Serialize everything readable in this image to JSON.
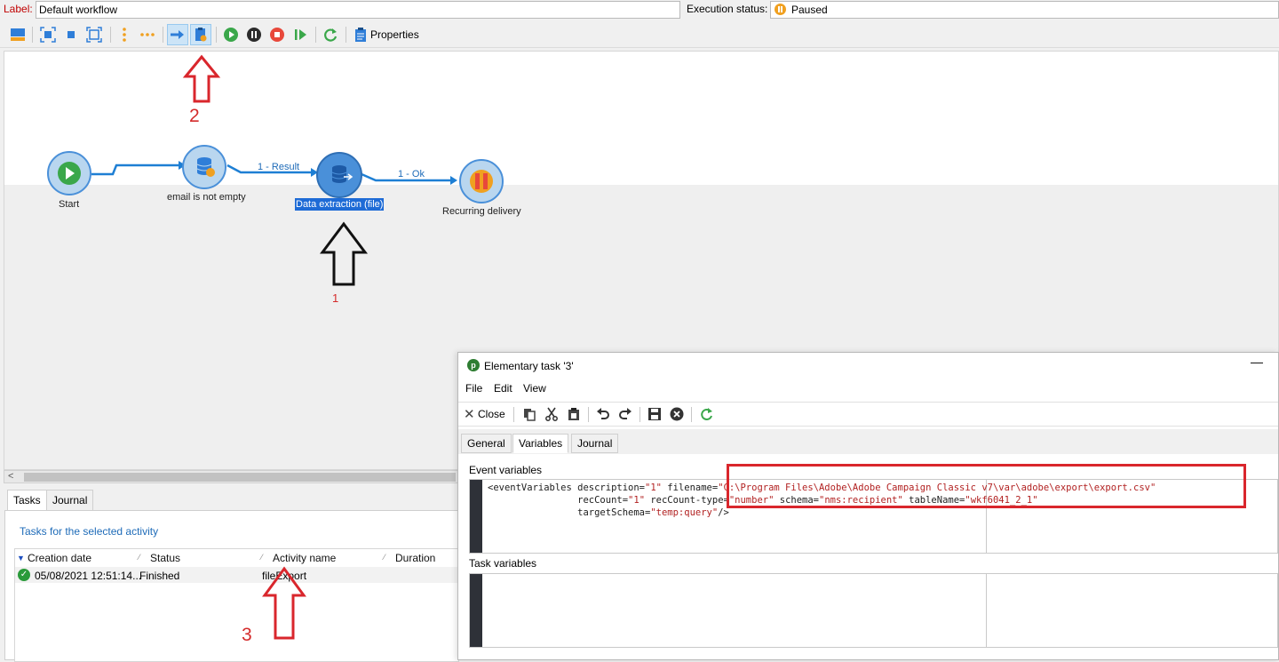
{
  "header": {
    "label_caption": "Label:",
    "label_value": "Default workflow",
    "exec_caption": "Execution status:",
    "exec_value": "Paused"
  },
  "toolbar": {
    "properties_label": "Properties"
  },
  "workflow": {
    "nodes": [
      {
        "id": "start",
        "label": "Start"
      },
      {
        "id": "query",
        "label": "email is not empty"
      },
      {
        "id": "extract",
        "label": "Data extraction (file)"
      },
      {
        "id": "delivery",
        "label": "Recurring delivery"
      }
    ],
    "transitions": [
      "1 - Result",
      "1 - Ok"
    ],
    "annotations": {
      "one": "1",
      "two": "2",
      "three": "3"
    }
  },
  "tasks_panel": {
    "tabs": [
      "Tasks",
      "Journal"
    ],
    "caption": "Tasks for the selected activity",
    "columns": [
      "Creation date",
      "Status",
      "Activity name",
      "Duration"
    ],
    "rows": [
      {
        "creation_date": "05/08/2021 12:51:14...",
        "status": "Finished",
        "activity_name": "fileExport",
        "duration": ""
      }
    ]
  },
  "dialog": {
    "title": "Elementary task '3'",
    "menu": [
      "File",
      "Edit",
      "View"
    ],
    "close_label": "Close",
    "tabs": [
      "General",
      "Variables",
      "Journal"
    ],
    "event_variables_label": "Event variables",
    "task_variables_label": "Task variables",
    "code": {
      "l1_a": "<eventVariables description=",
      "v_description": "\"1\"",
      "l1_b": " filename=",
      "v_filename": "\"C:\\Program Files\\Adobe\\Adobe Campaign Classic v7\\var\\adobe\\export\\export.csv\"",
      "l2_a": "                recCount=",
      "v_reccount": "\"1\"",
      "l2_b": " recCount-type=",
      "v_reccount_type": "\"number\"",
      "l2_c": " schema=",
      "v_schema": "\"nms:recipient\"",
      "l2_d": " tableName=",
      "v_tablename": "\"wkf6041_2_1\"",
      "l3_a": "                targetSchema=",
      "v_targetschema": "\"temp:query\"",
      "l3_b": "/>"
    }
  },
  "colors": {
    "accent_blue": "#1e6bb8",
    "annotation_red": "#d9262c",
    "node_blue": "#4a90d9",
    "paused_orange": "#f0a020"
  }
}
